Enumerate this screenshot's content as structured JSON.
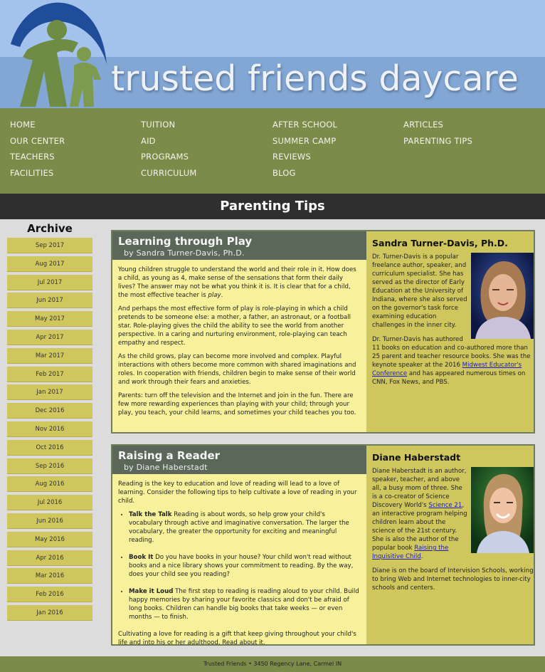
{
  "site": {
    "title": "trusted friends daycare",
    "colors": {
      "sky": "#a4c3ec",
      "nav": "#7a8b4a",
      "gold": "#cfc75e",
      "panel": "#f6f19a",
      "header": "#5a6759"
    }
  },
  "logo": {
    "icon": "family-logo-icon"
  },
  "nav": {
    "col1": [
      "HOME",
      "OUR CENTER",
      "TEACHERS",
      "FACILITIES"
    ],
    "col2": [
      "TUITION",
      "AID",
      "PROGRAMS",
      "CURRICULUM"
    ],
    "col3": [
      "AFTER SCHOOL",
      "SUMMER CAMP",
      "REVIEWS",
      "BLOG"
    ],
    "col4": [
      "ARTICLES",
      "PARENTING TIPS"
    ]
  },
  "page_title": "Parenting Tips",
  "archive": {
    "heading": "Archive",
    "items": [
      "Sep 2017",
      "Aug 2017",
      "Jul 2017",
      "Jun 2017",
      "May 2017",
      "Apr 2017",
      "Mar 2017",
      "Feb 2017",
      "Jan 2017",
      "Dec 2016",
      "Nov 2016",
      "Oct 2016",
      "Sep 2016",
      "Aug 2016",
      "Jul 2016",
      "Jun 2016",
      "May 2016",
      "Apr 2016",
      "Mar 2016",
      "Feb 2016",
      "Jan 2016"
    ]
  },
  "article1": {
    "title": "Learning through Play",
    "byline": "by Sandra Turner-Davis, Ph.D.",
    "p1_before": "Young children struggle to understand the world and their role in it. How does a child, as young as 4, make sense of the sensations that form their daily lives? The answer may not be what you think it is. It is clear that for a child, the most effective teacher is ",
    "p1_em": "play",
    "p1_after": ".",
    "p2": "And perhaps the most effective form of play is role-playing in which a child pretends to be someone else: a mother, a father, an astronaut, or a football star. Role-playing gives the child the ability to see the world from another perspective. In a caring and nurturing environment, role-playing can teach empathy and respect.",
    "p3": "As the child grows, play can become more involved and complex. Playful interactions with others become more common with shared imaginations and roles. In cooperation with friends, children begin to make sense of their world and work through their fears and anxieties.",
    "p4": "Parents: turn off the television and the Internet and join in the fun. There are few more rewarding experiences than playing with your child; through your play, you teach, your child learns, and sometimes your child teaches you too.",
    "author": {
      "name": "Sandra Turner-Davis, Ph.D.",
      "bio1": "Dr. Turner-Davis is a popular freelance author, speaker, and curriculum specialist. She has served as the director of Early Education at the University of Indiana, where she also served on the governor's task force examining education challenges in the inner city.",
      "bio2_before": "Dr. Turner-Davis has authored 11 books on education and co-authored more than 25 parent and teacher resource books. She was the keynote speaker at the 2016 ",
      "bio2_link": "Midwest Educator's Conference",
      "bio2_after": " and has appeared numerous times on CNN, Fox News, and PBS."
    }
  },
  "article2": {
    "title": "Raising a Reader",
    "byline": "by Diane Haberstadt",
    "intro": "Reading is the key to education and love of reading will lead to a love of learning. Consider the following tips to help cultivate a love of reading in your child.",
    "tips": [
      {
        "title": "Talk the Talk",
        "text": " Reading is about words, so help grow your child's vocabulary through active and imaginative conversation. The larger the vocabulary, the greater the opportunity for exciting and meaningful reading."
      },
      {
        "title": "Book It",
        "text": " Do you have books in your house? Your child won't read without books and a nice library shows your commitment to reading. By the way, does your child see you reading?"
      },
      {
        "title": "Make it Loud",
        "text": " The first step to reading is reading aloud to your child. Build happy memories by sharing your favorite classics and don't be afraid of long books. Children can handle big books that take weeks — or even months — to finish."
      }
    ],
    "outro": "Cultivating a love for reading is a gift that keep giving throughout your child's life and into his or her adulthood. Read about it.",
    "author": {
      "name": "Diane Haberstadt",
      "bio1_before": "Diane Haberstadt is an author, speaker, teacher, and above all, a busy mom of three. She is a co-creator of Science Discovery World's ",
      "bio1_link": "Science 21",
      "bio1_mid": ", an interactive program helping children learn about the science of the 21st century. She is also the author of the popular book ",
      "bio1_link2": "Raising the Inquisitive Child",
      "bio1_after": ".",
      "bio2": "Diane is on the board of Intervision Schools, working to bring Web and Internet technologies to inner-city schools and centers."
    }
  },
  "footer": "Trusted Friends • 3450 Regency Lane, Carmel IN"
}
